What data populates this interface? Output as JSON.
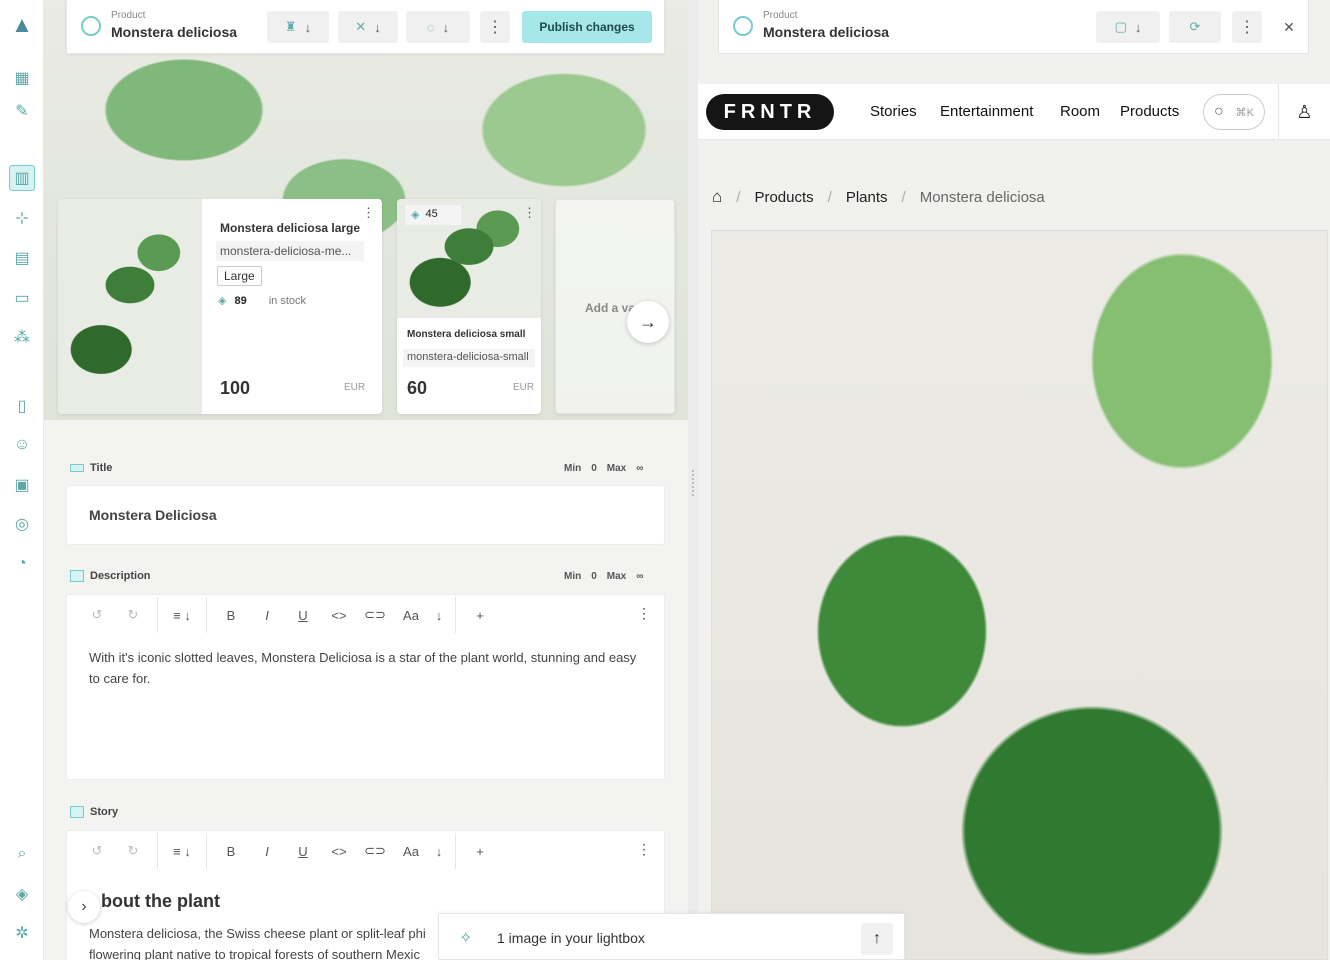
{
  "sidebar": {
    "icons": [
      "logo-icon",
      "dashboard-icon",
      "pipette-icon",
      "book-icon",
      "share-icon",
      "grid-icon",
      "image-icon",
      "components-icon",
      "clipboard-icon",
      "users-icon",
      "map-icon",
      "globe-icon",
      "chart-icon",
      "search-icon",
      "translate-icon",
      "settings-icon"
    ]
  },
  "editor": {
    "kicker": "Product",
    "title": "Monstera deliciosa",
    "publish_label": "Publish changes"
  },
  "variants": [
    {
      "name": "Monstera deliciosa large",
      "slug": "monstera-deliciosa-me...",
      "size": "Large",
      "stock": "89",
      "stock_label": "in stock",
      "price": "100",
      "currency": "EUR"
    },
    {
      "name": "Monstera deliciosa small",
      "slug": "monstera-deliciosa-small",
      "stock": "45",
      "price": "60",
      "currency": "EUR"
    }
  ],
  "add_variant_label": "Add a va",
  "fields": {
    "title": {
      "label": "Title",
      "min_label": "Min",
      "min": "0",
      "max_label": "Max",
      "max": "∞",
      "value": "Monstera Deliciosa"
    },
    "description": {
      "label": "Description",
      "min_label": "Min",
      "min": "0",
      "max_label": "Max",
      "max": "∞",
      "value": "With it's iconic slotted leaves, Monstera Deliciosa is a star of the plant world, stunning and easy to care for."
    },
    "story": {
      "label": "Story",
      "heading": "bout the plant",
      "text1": "Monstera deliciosa, the Swiss cheese plant or split-leaf phi",
      "text2": "flowering plant native to tropical forests of southern Mexic"
    }
  },
  "toolbar": {
    "text_style": "Aa",
    "bold": "B",
    "italic": "I",
    "underline": "U",
    "code": "<>",
    "add": "+"
  },
  "preview": {
    "kicker": "Product",
    "title": "Monstera deliciosa",
    "logo": "FRNTR",
    "nav": [
      "Stories",
      "Entertainment",
      "Room",
      "Products"
    ],
    "search_shortcut": "⌘K",
    "breadcrumbs": [
      "Products",
      "Plants",
      "Monstera deliciosa"
    ]
  },
  "lightbox": {
    "text": "1 image in your lightbox"
  }
}
